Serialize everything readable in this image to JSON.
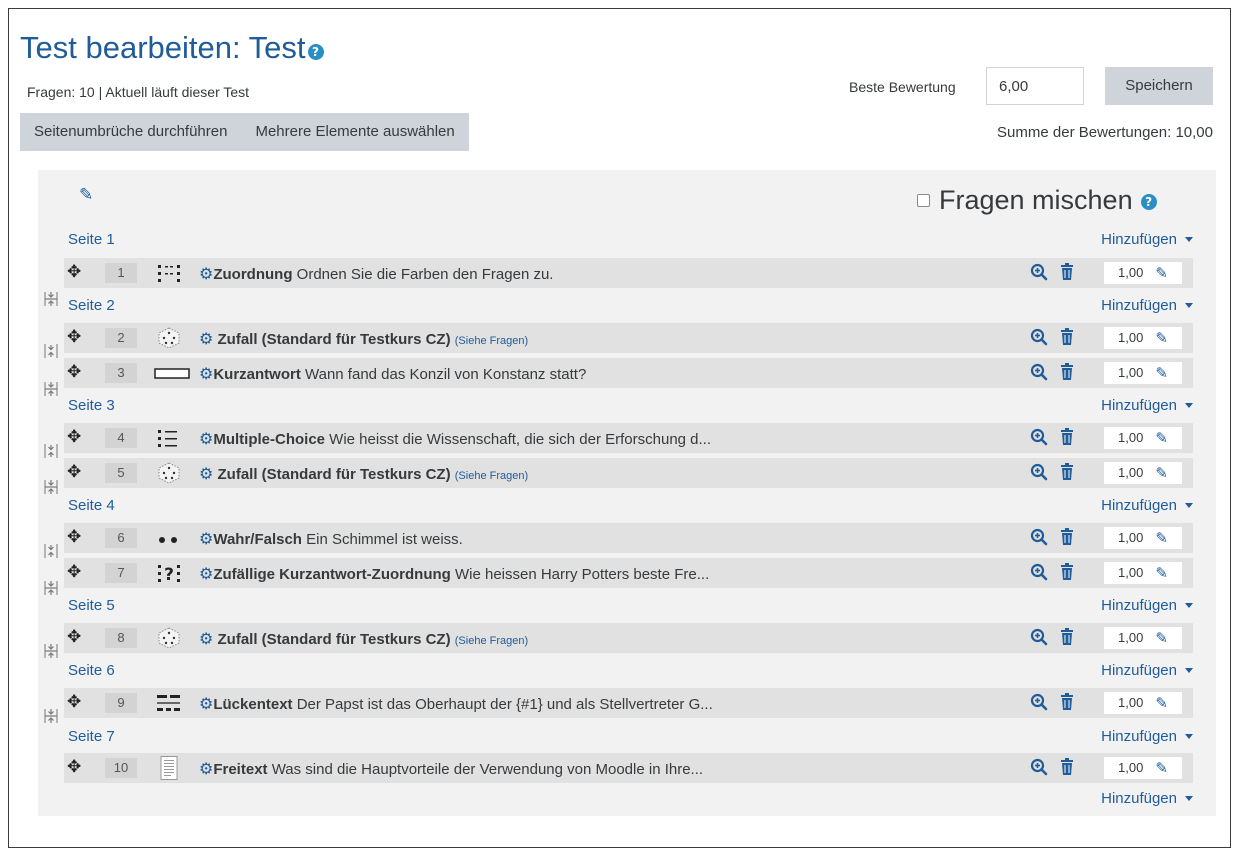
{
  "header": {
    "title": "Test bearbeiten: Test",
    "help_glyph": "?",
    "subtitle": "Fragen: 10 | Aktuell läuft dieser Test",
    "repaginate_label": "Seitenumbrüche durchführen",
    "select_multiple_label": "Mehrere Elemente auswählen",
    "max_grade_label": "Beste Bewertung",
    "max_grade_value": "6,00",
    "save_label": "Speichern",
    "total_marks": "Summe der Bewertungen: 10,00"
  },
  "shuffle": {
    "label": "Fragen mischen",
    "checked": false
  },
  "add_label": "Hinzufügen",
  "pages": [
    {
      "label": "Seite 1"
    },
    {
      "label": "Seite 2"
    },
    {
      "label": "Seite 3"
    },
    {
      "label": "Seite 4"
    },
    {
      "label": "Seite 5"
    },
    {
      "label": "Seite 6"
    },
    {
      "label": "Seite 7"
    }
  ],
  "questions": [
    {
      "num": "1",
      "type": "Zuordnung",
      "icon": "matching-icon",
      "text": " Ordnen Sie die Farben den Fragen zu.",
      "extra": "",
      "mark": "1,00"
    },
    {
      "num": "2",
      "type": " Zufall (Standard für Testkurs CZ)",
      "icon": "random-dice-icon",
      "text": " ",
      "extra": "(Siehe Fragen)",
      "mark": "1,00"
    },
    {
      "num": "3",
      "type": "Kurzantwort",
      "icon": "short-answer-icon",
      "text": " Wann fand das Konzil von Konstanz statt?",
      "extra": "",
      "mark": "1,00"
    },
    {
      "num": "4",
      "type": "Multiple-Choice",
      "icon": "multiple-choice-icon",
      "text": " Wie heisst die Wissenschaft, die sich der Erforschung d...",
      "extra": "",
      "mark": "1,00"
    },
    {
      "num": "5",
      "type": " Zufall (Standard für Testkurs CZ)",
      "icon": "random-dice-icon",
      "text": " ",
      "extra": "(Siehe Fragen)",
      "mark": "1,00"
    },
    {
      "num": "6",
      "type": "Wahr/Falsch",
      "icon": "true-false-icon",
      "text": " Ein Schimmel ist weiss.",
      "extra": "",
      "mark": "1,00"
    },
    {
      "num": "7",
      "type": "Zufällige Kurzantwort-Zuordnung",
      "icon": "random-short-answer-matching-icon",
      "text": " Wie heissen Harry Potters beste Fre...",
      "extra": "",
      "mark": "1,00"
    },
    {
      "num": "8",
      "type": " Zufall (Standard für Testkurs CZ)",
      "icon": "random-dice-icon",
      "text": " ",
      "extra": "(Siehe Fragen)",
      "mark": "1,00"
    },
    {
      "num": "9",
      "type": "Lückentext",
      "icon": "cloze-icon",
      "text": " Der Papst ist das Oberhaupt der {#1} und als Stellvertreter G...",
      "extra": "",
      "mark": "1,00"
    },
    {
      "num": "10",
      "type": "Freitext",
      "icon": "essay-icon",
      "text": " Was sind die Hauptvorteile der Verwendung von Moodle in Ihre...",
      "extra": "",
      "mark": "1,00"
    }
  ],
  "colors": {
    "accent": "#1f5c99",
    "row_bg": "#e1e1e1",
    "panel_bg": "#f2f2f2",
    "button_bg": "#ced4da"
  }
}
